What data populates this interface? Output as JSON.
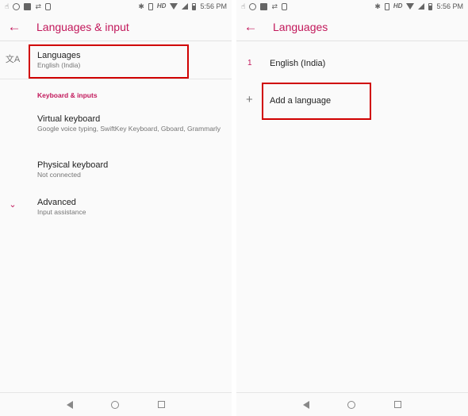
{
  "left": {
    "status": {
      "time": "5:56 PM",
      "hd": "HD"
    },
    "appbar": {
      "back_icon": "arrow-back-icon",
      "title": "Languages & input"
    },
    "languages": {
      "title": "Languages",
      "subtitle": "English (India)",
      "icon": "translate-icon"
    },
    "section_header": "Keyboard & inputs",
    "virtual_keyboard": {
      "title": "Virtual keyboard",
      "subtitle": "Google voice typing, SwiftKey Keyboard, Gboard, Grammarly"
    },
    "physical_keyboard": {
      "title": "Physical keyboard",
      "subtitle": "Not connected"
    },
    "advanced": {
      "title": "Advanced",
      "subtitle": "Input assistance",
      "icon": "chevron-down-icon"
    }
  },
  "right": {
    "status": {
      "time": "5:56 PM",
      "hd": "HD"
    },
    "appbar": {
      "back_icon": "arrow-back-icon",
      "title": "Languages"
    },
    "language_list": [
      {
        "index": "1",
        "name": "English (India)"
      }
    ],
    "add_language": {
      "label": "Add a language",
      "icon": "plus-icon"
    }
  },
  "colors": {
    "accent": "#c2185b",
    "highlight": "#d00000"
  }
}
